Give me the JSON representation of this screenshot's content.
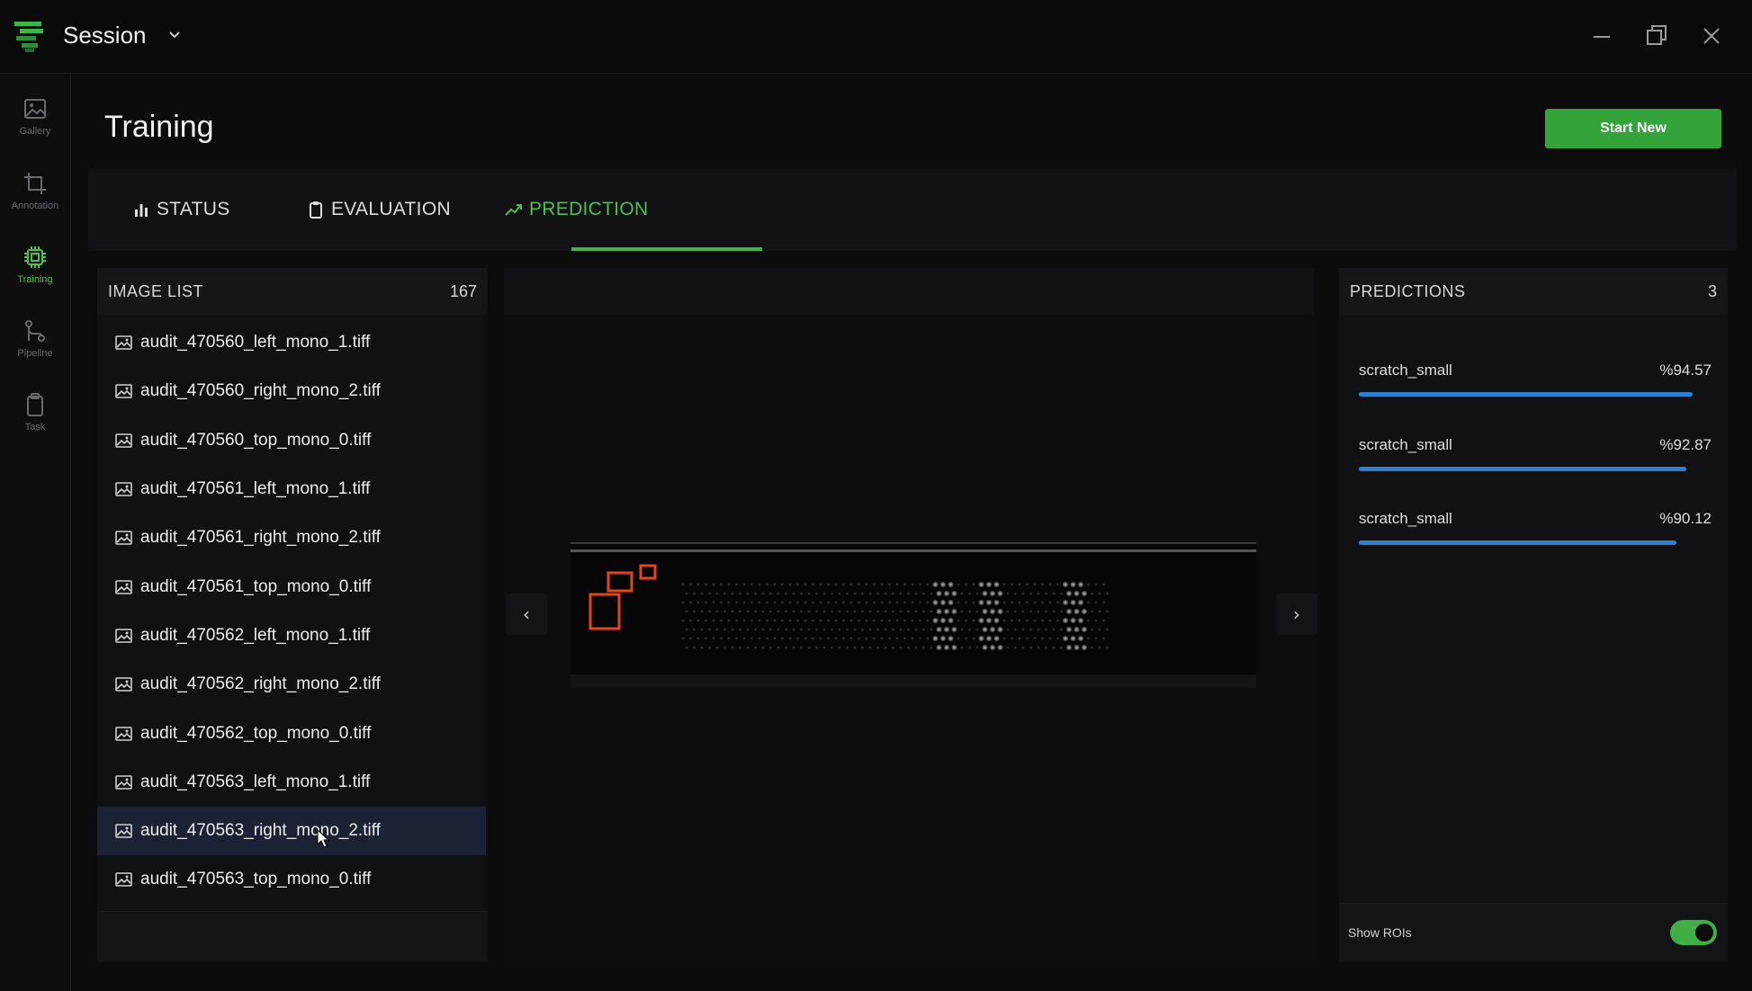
{
  "app": {
    "title": "Session",
    "brand_color": "#3fb547"
  },
  "window_controls": [
    "minimize-icon",
    "restore-icon",
    "close-icon"
  ],
  "rail": {
    "items": [
      {
        "label": "Gallery",
        "icon": "image-icon",
        "active": false
      },
      {
        "label": "Annotation",
        "icon": "crop-icon",
        "active": false
      },
      {
        "label": "Training",
        "icon": "chip-icon",
        "active": true
      },
      {
        "label": "Pipeline",
        "icon": "pipeline-icon",
        "active": false
      },
      {
        "label": "Task",
        "icon": "clipboard-icon",
        "active": false
      }
    ]
  },
  "page": {
    "title": "Training",
    "start_button": "Start New"
  },
  "tabs": [
    {
      "label": "STATUS",
      "icon": "bar-chart-icon",
      "active": false
    },
    {
      "label": "EVALUATION",
      "icon": "clipboard-icon",
      "active": false
    },
    {
      "label": "PREDICTION",
      "icon": "trend-icon",
      "active": true
    }
  ],
  "image_list": {
    "title": "IMAGE LIST",
    "count": "167",
    "selected_index": 10,
    "items": [
      "audit_470560_left_mono_1.tiff",
      "audit_470560_right_mono_2.tiff",
      "audit_470560_top_mono_0.tiff",
      "audit_470561_left_mono_1.tiff",
      "audit_470561_right_mono_2.tiff",
      "audit_470561_top_mono_0.tiff",
      "audit_470562_left_mono_1.tiff",
      "audit_470562_right_mono_2.tiff",
      "audit_470562_top_mono_0.tiff",
      "audit_470563_left_mono_1.tiff",
      "audit_470563_right_mono_2.tiff",
      "audit_470563_top_mono_0.tiff"
    ]
  },
  "viewer": {
    "prev": "‹",
    "next": "›"
  },
  "predictions": {
    "title": "PREDICTIONS",
    "count": "3",
    "items": [
      {
        "label": "scratch_small",
        "score": "%94.57",
        "value": 94.57
      },
      {
        "label": "scratch_small",
        "score": "%92.87",
        "value": 92.87
      },
      {
        "label": "scratch_small",
        "score": "%90.12",
        "value": 90.12
      }
    ],
    "bar_color": "#2f7fd0",
    "show_rois_label": "Show ROIs",
    "show_rois_on": true
  }
}
